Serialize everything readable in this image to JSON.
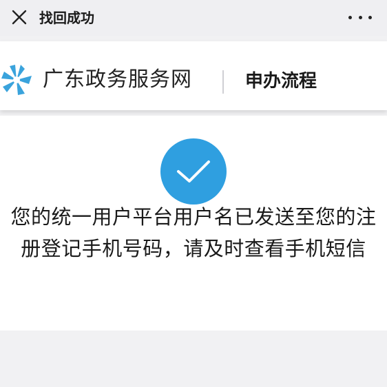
{
  "topbar": {
    "close_icon": "close-icon",
    "title": "找回成功",
    "more_icon": "more-dots-icon"
  },
  "header": {
    "logo_icon": "guangdong-gov-logo-icon",
    "site_name": "广东政务服务网",
    "process_link": "申办流程"
  },
  "result": {
    "status_icon": "check-circle-icon",
    "message": "您的统一用户平台用户名已发送至您的注册登记手机号码，请及时查看手机短信"
  },
  "colors": {
    "accent": "#2f9fe0",
    "logo": "#3aa3dc",
    "topbar_bg": "#efeff2",
    "page_bg": "#f1f1f3"
  }
}
